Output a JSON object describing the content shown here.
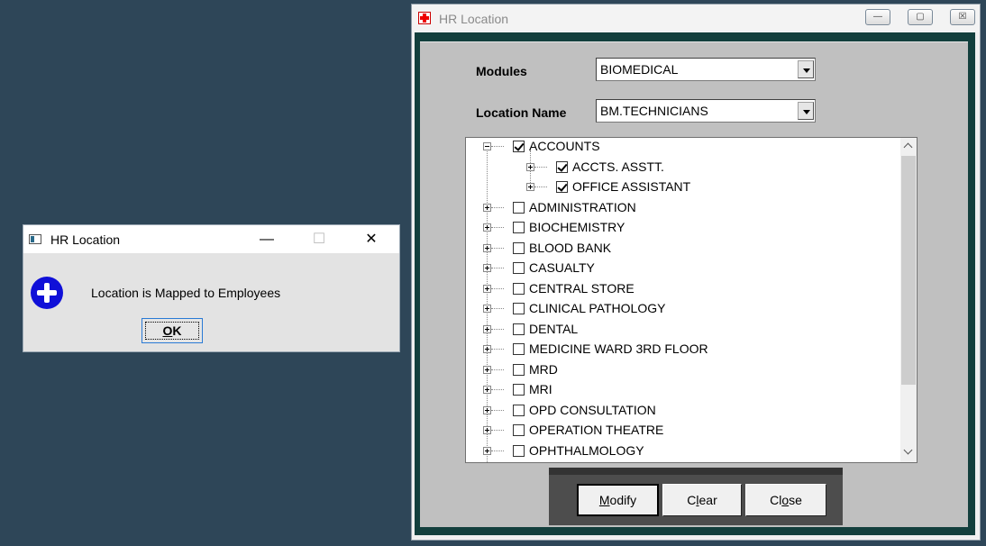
{
  "main_window": {
    "title": "HR Location",
    "controls": {
      "minimize": "—",
      "maximize": "▢",
      "close": "☒"
    },
    "modules": {
      "label": "Modules",
      "value": "BIOMEDICAL"
    },
    "location": {
      "label": "Location Name",
      "value": "BM.TECHNICIANS"
    },
    "tree": {
      "root": {
        "label": "ACCOUNTS",
        "checked": true,
        "expanded": true
      },
      "children": [
        {
          "label": "ACCTS. ASSTT.",
          "checked": true
        },
        {
          "label": "OFFICE ASSISTANT",
          "checked": true
        }
      ],
      "items": [
        "ADMINISTRATION",
        "BIOCHEMISTRY",
        "BLOOD BANK",
        "CASUALTY",
        "CENTRAL STORE",
        "CLINICAL PATHOLOGY",
        "DENTAL",
        "MEDICINE WARD 3RD FLOOR",
        "MRD",
        "MRI",
        "OPD CONSULTATION",
        "OPERATION THEATRE",
        "OPHTHALMOLOGY"
      ]
    },
    "buttons": {
      "modify": "Modify",
      "clear": "Clear",
      "close": "Close"
    }
  },
  "dialog": {
    "title": "HR Location",
    "controls": {
      "minimize": "—",
      "maximize": "☐",
      "close": "✕"
    },
    "message": "Location is Mapped to Employees",
    "ok_label": "OK"
  }
}
